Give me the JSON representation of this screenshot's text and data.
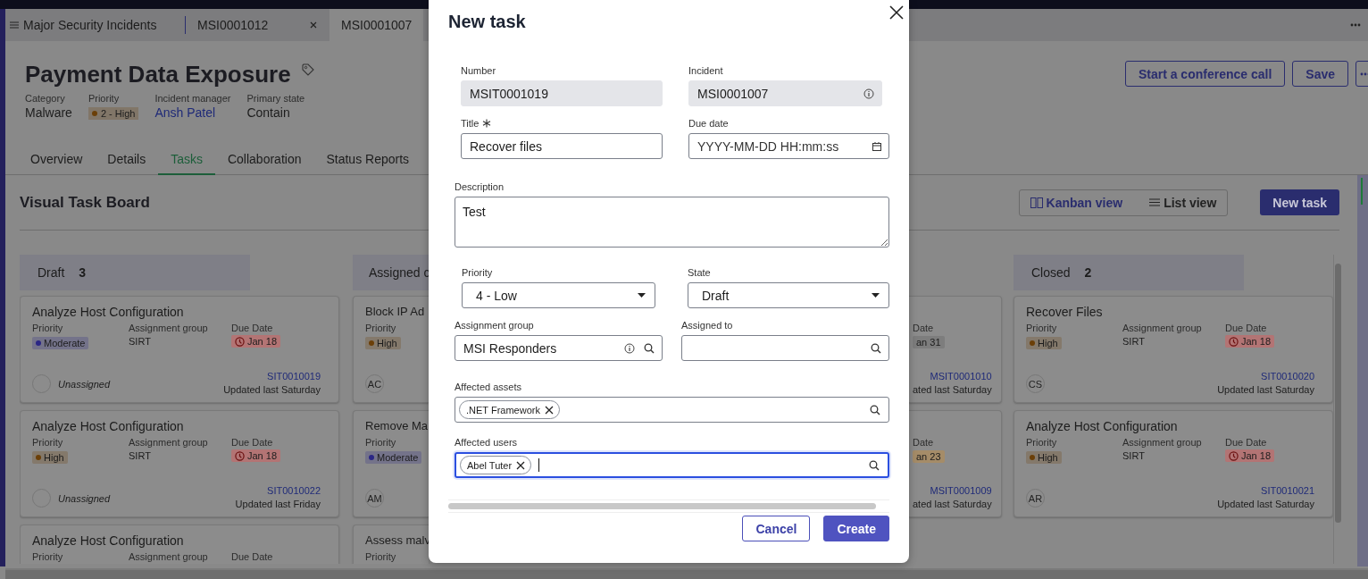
{
  "app_tabs": [
    {
      "label": "Major Security Incidents",
      "kind": "list",
      "selected": false
    },
    {
      "label": "MSI0001012",
      "kind": "record",
      "selected": false
    },
    {
      "label": "MSI0001007",
      "kind": "record",
      "selected": true
    }
  ],
  "record": {
    "title": "Payment Data Exposure",
    "fields": [
      {
        "label": "Category",
        "kind": "text",
        "value": "Malware"
      },
      {
        "label": "Priority",
        "kind": "badge",
        "value": "2 - High",
        "color": "#6b3f08"
      },
      {
        "label": "Incident manager",
        "kind": "link",
        "value": "Ansh Patel"
      },
      {
        "label": "Primary state",
        "kind": "text",
        "value": "Contain"
      }
    ],
    "actions": [
      "Start a conference call",
      "Save"
    ]
  },
  "tabs": [
    {
      "label": "Overview",
      "selected": false
    },
    {
      "label": "Details",
      "selected": false
    },
    {
      "label": "Tasks",
      "selected": true
    },
    {
      "label": "Collaboration",
      "selected": false
    },
    {
      "label": "Status Reports",
      "selected": false
    }
  ],
  "board": {
    "title": "Visual Task Board",
    "views": [
      {
        "label": "Kanban view",
        "kind": "kanban",
        "selected": true
      },
      {
        "label": "List view",
        "kind": "list",
        "selected": false
      }
    ],
    "new_button": "New task",
    "columns": [
      {
        "kind": "full",
        "name": "Draft",
        "count": "3",
        "cards": [
          {
            "title": "Analyze Host Configuration",
            "fields": [
              {
                "label": "Priority",
                "kind": "priority",
                "value": "Moderate",
                "color": "#2b2785"
              },
              {
                "label": "Assignment group",
                "kind": "text",
                "value": "SIRT"
              },
              {
                "label": "Due Date",
                "kind": "due",
                "value": "Jan 18",
                "color": "#b37474",
                "overdue": true
              }
            ],
            "assignee": {
              "kind": "unassigned",
              "label": "Unassigned"
            },
            "number": "SIT0010019",
            "updated": "Updated last Saturday"
          },
          {
            "title": "Analyze Host Configuration",
            "fields": [
              {
                "label": "Priority",
                "kind": "priority",
                "value": "High",
                "color": "#6b3f08"
              },
              {
                "label": "Assignment group",
                "kind": "text",
                "value": "SIRT"
              },
              {
                "label": "Due Date",
                "kind": "due",
                "value": "Jan 18",
                "color": "#b37474",
                "overdue": true
              }
            ],
            "assignee": {
              "kind": "unassigned",
              "label": "Unassigned"
            },
            "number": "SIT0010022",
            "updated": "Updated last Friday"
          },
          {
            "title": "Analyze Host Configuration",
            "fields": [
              {
                "label": "Priority",
                "kind": "priority"
              },
              {
                "label": "Assignment group",
                "kind": "text"
              },
              {
                "label": "Due Date",
                "kind": "due"
              }
            ]
          }
        ]
      },
      {
        "kind": "left_fragment",
        "name": "Assigned c",
        "cards": [
          {
            "title": "Block IP Ad",
            "fields": [
              {
                "label": "Priority",
                "kind": "priority",
                "value": "High",
                "color": "#6b3f08"
              }
            ],
            "assignee": {
              "kind": "initials",
              "label": "AC"
            }
          },
          {
            "title": "Remove Ma",
            "fields": [
              {
                "label": "Priority",
                "kind": "priority",
                "value": "Moderate",
                "color": "#2b2785"
              }
            ],
            "assignee": {
              "kind": "initials",
              "label": "AM"
            }
          },
          {
            "title": "Assess malv",
            "fields": [
              {
                "label": "Priority",
                "kind": "priority"
              }
            ]
          }
        ]
      },
      {
        "kind": "right_fragment",
        "cards": [
          {
            "fields": [
              {
                "label": "Date",
                "kind": "due",
                "value": "an 31",
                "color": "#7d7d7d",
                "overdue": false
              }
            ],
            "number": "MSIT0001010",
            "updated": "ated last Saturday"
          },
          {
            "fields": [
              {
                "label": "Date",
                "kind": "due",
                "value": "an 23",
                "color": "#a58c68",
                "overdue": false
              }
            ],
            "number": "MSIT0001009",
            "updated": "ated last Saturday"
          }
        ]
      },
      {
        "kind": "full",
        "name": "Closed",
        "count": "2",
        "cards": [
          {
            "title": "Recover Files",
            "fields": [
              {
                "label": "Priority",
                "kind": "priority",
                "value": "High",
                "color": "#6b3f08"
              },
              {
                "label": "Assignment group",
                "kind": "text",
                "value": "SIRT"
              },
              {
                "label": "Due Date",
                "kind": "due",
                "value": "Jan 18",
                "color": "#b37474",
                "overdue": true
              }
            ],
            "assignee": {
              "kind": "initials",
              "label": "CS"
            },
            "number": "SIT0010020",
            "updated": "Updated last Saturday"
          },
          {
            "title": "Analyze Host Configuration",
            "fields": [
              {
                "label": "Priority",
                "kind": "priority",
                "value": "High",
                "color": "#6b3f08"
              },
              {
                "label": "Assignment group",
                "kind": "text",
                "value": "SIRT"
              },
              {
                "label": "Due Date",
                "kind": "due",
                "value": "Jan 18",
                "color": "#b37474",
                "overdue": true
              }
            ],
            "assignee": {
              "kind": "initials",
              "label": "AR"
            },
            "number": "SIT0010021",
            "updated": "Updated last Saturday"
          }
        ]
      }
    ]
  },
  "dialog": {
    "title": "New task",
    "fields": [
      {
        "label": "Number",
        "kind": "readonly",
        "value": "MSIT0001019"
      },
      {
        "label": "Incident",
        "kind": "readonly",
        "value": "MSI0001007",
        "info": true
      },
      {
        "label": "Title",
        "kind": "text",
        "value": "Recover files",
        "required": true
      },
      {
        "label": "Due date",
        "kind": "date",
        "placeholder": "YYYY-MM-DD HH:mm:ss"
      },
      {
        "label": "Description",
        "kind": "textarea",
        "value": "Test"
      },
      {
        "label": "Priority",
        "kind": "select",
        "value": "4 - Low"
      },
      {
        "label": "State",
        "kind": "select",
        "value": "Draft"
      },
      {
        "label": "Assignment group",
        "kind": "reference",
        "value": "MSI Responders",
        "info": true
      },
      {
        "label": "Assigned to",
        "kind": "reference"
      },
      {
        "label": "Affected assets",
        "kind": "chips",
        "chips": [
          ".NET Framework"
        ],
        "focused": false
      },
      {
        "label": "Affected users",
        "kind": "chips",
        "chips": [
          "Abel Tuter"
        ],
        "focused": true
      }
    ],
    "buttons": [
      {
        "label": "Cancel",
        "kind": "secondary"
      },
      {
        "label": "Create",
        "kind": "primary"
      }
    ]
  }
}
